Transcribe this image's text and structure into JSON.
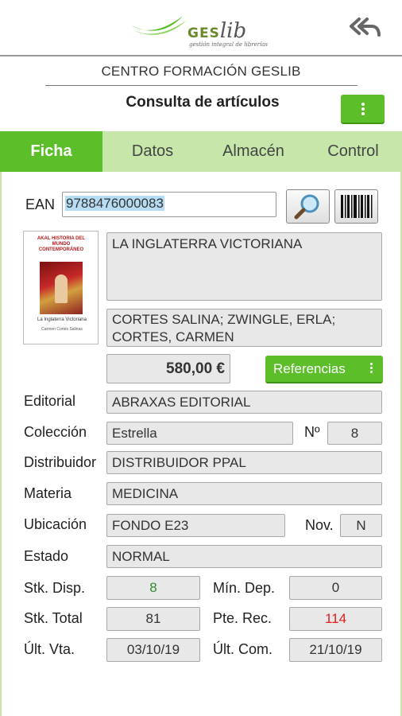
{
  "header": {
    "logo_brand": "GES",
    "logo_brand_italic": "lib",
    "logo_tagline": "gestión integral de librerías",
    "back_icon": "reply-all-icon"
  },
  "center_name": "CENTRO FORMACIÓN GESLIB",
  "page_title": "Consulta de artículos",
  "menu_icon": "more-vert-icon",
  "tabs": [
    {
      "label": "Ficha",
      "active": true
    },
    {
      "label": "Datos",
      "active": false
    },
    {
      "label": "Almacén",
      "active": false
    },
    {
      "label": "Control",
      "active": false
    }
  ],
  "ean": {
    "label": "EAN",
    "value": "9788476000083"
  },
  "search_icon": "magnifier-icon",
  "barcode_icon": "barcode-icon",
  "book": {
    "cover_series": "AKAL HISTORIA DEL MUNDO CONTEMPORÁNEO",
    "cover_title": "La Inglaterra Victoriana",
    "cover_author": "Carmen Cortés Salinas",
    "title": "LA INGLATERRA VICTORIANA",
    "authors": "CORTES SALINA; ZWINGLE, ERLA; CORTES, CARMEN",
    "price": "580,00 €",
    "references_label": "Referencias"
  },
  "fields": {
    "editorial": {
      "label": "Editorial",
      "value": "ABRAXAS EDITORIAL"
    },
    "coleccion": {
      "label": "Colección",
      "value": "Estrella"
    },
    "numero": {
      "label": "Nº",
      "value": "8"
    },
    "distribuidor": {
      "label": "Distribuidor",
      "value": "DISTRIBUIDOR PPAL"
    },
    "materia": {
      "label": "Materia",
      "value": "MEDICINA"
    },
    "ubicacion": {
      "label": "Ubicación",
      "value": "FONDO E23"
    },
    "novedad": {
      "label": "Nov.",
      "value": "N"
    },
    "estado": {
      "label": "Estado",
      "value": "NORMAL"
    }
  },
  "stock": {
    "disp": {
      "label": "Stk. Disp.",
      "value": "8",
      "color": "#2e8b2e"
    },
    "min_dep": {
      "label": "Mín. Dep.",
      "value": "0"
    },
    "total": {
      "label": "Stk. Total",
      "value": "81"
    },
    "pte_rec": {
      "label": "Pte. Rec.",
      "value": "114",
      "color": "#e02020"
    },
    "ult_vta": {
      "label": "Últ. Vta.",
      "value": "03/10/19"
    },
    "ult_com": {
      "label": "Últ. Com.",
      "value": "21/10/19"
    }
  },
  "colors": {
    "accent": "#5cbf2a",
    "tab_bar": "#c7e6aa"
  }
}
